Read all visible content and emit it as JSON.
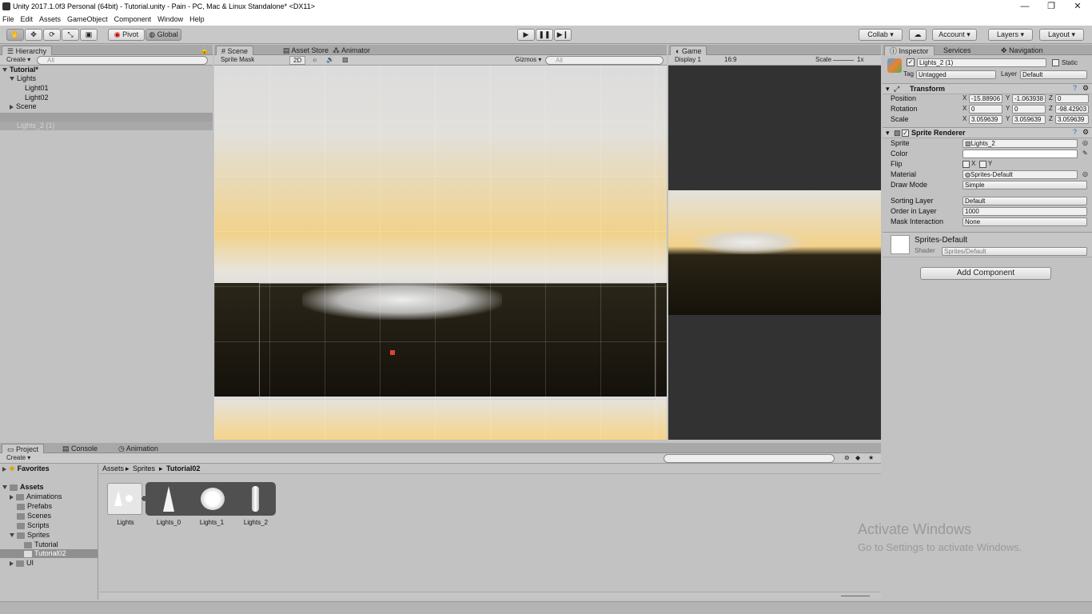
{
  "window": {
    "title": "Unity 2017.1.0f3 Personal (64bit) - Tutorial.unity - Pain - PC, Mac & Linux Standalone* <DX11>",
    "min": "—",
    "max": "❐",
    "close": "✕"
  },
  "menu": [
    "File",
    "Edit",
    "Assets",
    "GameObject",
    "Component",
    "Window",
    "Help"
  ],
  "toolbar": {
    "pivot": "Pivot",
    "global": "Global",
    "collab": "Collab ▾",
    "account": "Account",
    "layers": "Layers",
    "layout": "Layout"
  },
  "hierarchy": {
    "tab": "Hierarchy",
    "create": "Create ▾",
    "search": "All",
    "scene": "Tutorial*",
    "items": [
      "Lights",
      "Light01",
      "Light02",
      "Scene"
    ],
    "selected": "Lights_2 (1)"
  },
  "scene": {
    "tabs": [
      "Scene",
      "Asset Store",
      "Animator"
    ],
    "draw_mode": "Sprite Mask",
    "mode_2d": "2D",
    "gizmos": "Gizmos ▾",
    "search": "All"
  },
  "game": {
    "tab": "Game",
    "display": "Display 1",
    "aspect": "16:9",
    "scale_label": "Scale",
    "scale_value": "1x"
  },
  "inspector": {
    "tabs": [
      "Inspector",
      "Services",
      "Navigation"
    ],
    "object_name": "Lights_2 (1)",
    "static": "Static",
    "tag_label": "Tag",
    "tag": "Untagged",
    "layer_label": "Layer",
    "layer": "Default",
    "transform": {
      "title": "Transform",
      "position_label": "Position",
      "rotation_label": "Rotation",
      "scale_label": "Scale",
      "position": [
        "-15.88906",
        "-1.063938",
        "0"
      ],
      "rotation": [
        "0",
        "0",
        "-98.42903"
      ],
      "scale": [
        "3.059639",
        "3.059639",
        "3.059639"
      ]
    },
    "sprite_renderer": {
      "title": "Sprite Renderer",
      "sprite_label": "Sprite",
      "sprite": "Lights_2",
      "color_label": "Color",
      "flip_label": "Flip",
      "flip_x": "X",
      "flip_y": "Y",
      "material_label": "Material",
      "material": "Sprites-Default",
      "draw_mode_label": "Draw Mode",
      "draw_mode": "Simple",
      "sorting_layer_label": "Sorting Layer",
      "sorting_layer": "Default",
      "order_label": "Order in Layer",
      "order": "1000",
      "mask_label": "Mask Interaction",
      "mask": "None"
    },
    "material_block": {
      "name": "Sprites-Default",
      "shader_label": "Shader",
      "shader": "Sprites/Default"
    },
    "add_component": "Add Component"
  },
  "project": {
    "tabs": [
      "Project",
      "Console",
      "Animation"
    ],
    "create": "Create ▾",
    "favorites": "Favorites",
    "assets": "Assets",
    "tree": [
      "Animations",
      "Prefabs",
      "Scenes",
      "Scripts",
      "Sprites",
      "Tutorial",
      "Tutorial02",
      "UI"
    ],
    "breadcrumb": [
      "Assets",
      "Sprites",
      "Tutorial02"
    ],
    "asset_items": [
      "Lights",
      "Lights_0",
      "Lights_1",
      "Lights_2"
    ]
  },
  "watermark": {
    "line1": "Activate Windows",
    "line2": "Go to Settings to activate Windows."
  },
  "colors": {
    "panel": "#c2c2c2",
    "tab_active": "#c8c8c8",
    "selection": "#8f8f8f",
    "sky": "#f1c978",
    "ground": "#1e1a12"
  }
}
